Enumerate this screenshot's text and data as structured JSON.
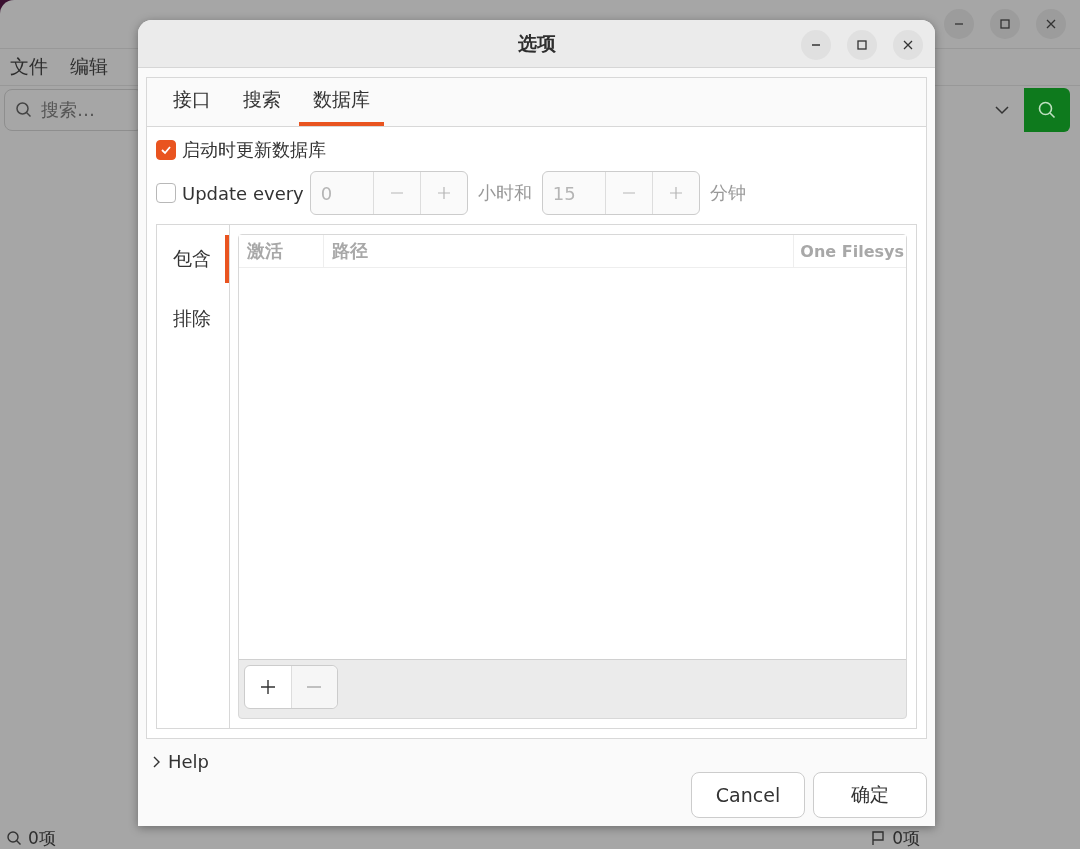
{
  "background_window": {
    "menu": [
      "文件",
      "编辑"
    ],
    "search": {
      "placeholder": "搜索…"
    },
    "status_left": "0项",
    "status_right": "0项"
  },
  "dialog": {
    "title": "选项",
    "tabs": [
      {
        "label": "接口",
        "selected": false
      },
      {
        "label": "搜索",
        "selected": false
      },
      {
        "label": "数据库",
        "selected": true
      }
    ],
    "update_on_start": {
      "label": "启动时更新数据库",
      "checked": true
    },
    "update_every": {
      "label": "Update every",
      "checked": false,
      "hours": "0",
      "hours_label": "小时和",
      "minutes": "15",
      "minutes_label": "分钟",
      "disabled": true
    },
    "side_tabs": [
      {
        "label": "包含",
        "selected": true
      },
      {
        "label": "排除",
        "selected": false
      }
    ],
    "table": {
      "columns": [
        "激活",
        "路径",
        "One Filesys"
      ]
    },
    "list_buttons": [
      {
        "kind": "add",
        "disabled": false
      },
      {
        "kind": "remove",
        "disabled": true
      }
    ],
    "help": "Help",
    "buttons": [
      "Cancel",
      "确定"
    ]
  }
}
